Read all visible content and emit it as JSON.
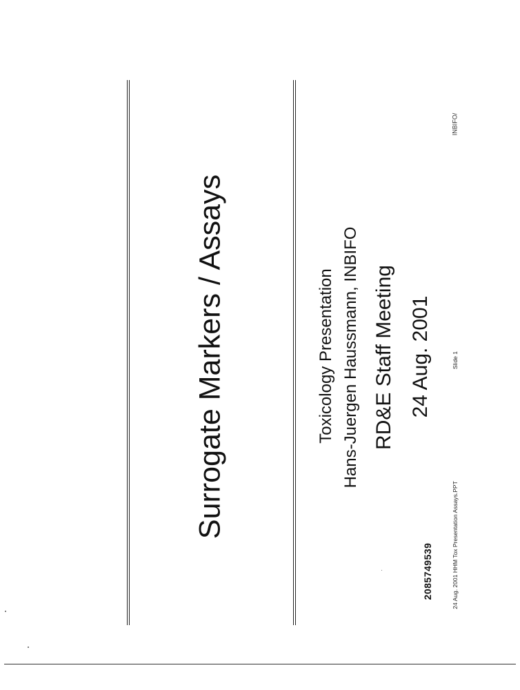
{
  "slide": {
    "title": "Surrogate Markers / Assays",
    "lines": [
      "Toxicology Presentation",
      "Hans-Juergen Haussmann, INBIFO",
      "RD&E Staff Meeting",
      "24 Aug. 2001"
    ]
  },
  "footer": {
    "left": "24 Aug. 2001    HHM    Tox Presentation Assays.PPT",
    "slide_number": "Slide 1",
    "org": "INBIFO/"
  },
  "document_number": "2085749539"
}
